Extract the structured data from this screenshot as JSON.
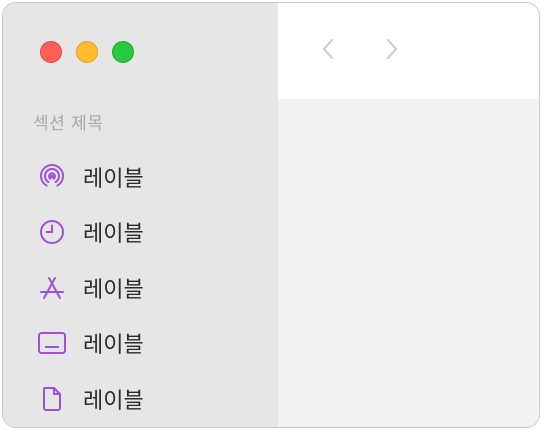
{
  "window": {
    "traffic_lights": [
      {
        "name": "close",
        "color": "#fe5f57"
      },
      {
        "name": "minimize",
        "color": "#febc2e"
      },
      {
        "name": "zoom",
        "color": "#28c840"
      }
    ]
  },
  "sidebar": {
    "section_title": "섹션 제목",
    "accent_color": "#a050d8",
    "items": [
      {
        "icon": "airdrop-icon",
        "label": "레이블"
      },
      {
        "icon": "clock-icon",
        "label": "레이블"
      },
      {
        "icon": "app-store-icon",
        "label": "레이블"
      },
      {
        "icon": "display-icon",
        "label": "레이블"
      },
      {
        "icon": "document-icon",
        "label": "레이블"
      }
    ]
  },
  "toolbar": {
    "back_icon": "chevron-left-icon",
    "forward_icon": "chevron-right-icon",
    "nav_color": "#c9c9c9"
  }
}
